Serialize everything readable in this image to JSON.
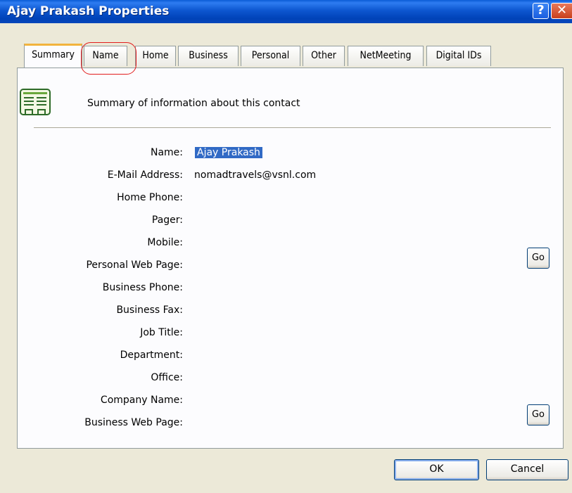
{
  "window": {
    "title": "Ajay Prakash Properties"
  },
  "tabs": [
    {
      "label": "Summary"
    },
    {
      "label": "Name"
    },
    {
      "label": "Home"
    },
    {
      "label": "Business"
    },
    {
      "label": "Personal"
    },
    {
      "label": "Other"
    },
    {
      "label": "NetMeeting"
    },
    {
      "label": "Digital IDs"
    }
  ],
  "summary": {
    "description": "Summary of information about this contact",
    "fields": [
      {
        "label": "Name:",
        "value": "Ajay Prakash"
      },
      {
        "label": "E-Mail Address:",
        "value": "nomadtravels@vsnl.com"
      },
      {
        "label": "Home Phone:",
        "value": ""
      },
      {
        "label": "Pager:",
        "value": ""
      },
      {
        "label": "Mobile:",
        "value": ""
      },
      {
        "label": "Personal Web Page:",
        "value": ""
      },
      {
        "label": "Business Phone:",
        "value": ""
      },
      {
        "label": "Business Fax:",
        "value": ""
      },
      {
        "label": "Job Title:",
        "value": ""
      },
      {
        "label": "Department:",
        "value": ""
      },
      {
        "label": "Office:",
        "value": ""
      },
      {
        "label": "Company Name:",
        "value": ""
      },
      {
        "label": "Business Web Page:",
        "value": ""
      }
    ],
    "go_personal_label": "Go",
    "go_business_label": "Go"
  },
  "footer": {
    "ok_label": "OK",
    "cancel_label": "Cancel"
  },
  "colors": {
    "titlebar": "#0a55d2",
    "selection": "#316ac5",
    "annotation_ring": "#e21d1d",
    "active_tab_accent": "#f2b33d"
  },
  "icons": {
    "help": "help-icon",
    "close": "close-icon",
    "contact_card": "contact-card-icon"
  }
}
